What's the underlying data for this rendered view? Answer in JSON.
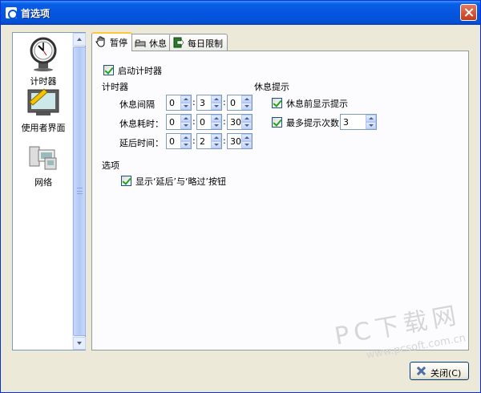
{
  "window": {
    "title": "首选项"
  },
  "nav": {
    "items": [
      {
        "label": "计时器",
        "icon": "clock-icon"
      },
      {
        "label": "使用者界面",
        "icon": "monitor-icon"
      },
      {
        "label": "网络",
        "icon": "network-icon"
      }
    ]
  },
  "tabs": [
    {
      "label": "暂停",
      "icon": "hand-icon"
    },
    {
      "label": "休息",
      "icon": "bed-icon"
    },
    {
      "label": "每日限制",
      "icon": "exit-icon"
    }
  ],
  "panel": {
    "enable_timer": {
      "label": "启动计时器",
      "checked": true
    },
    "timer_section": {
      "heading": "计时器",
      "rows": [
        {
          "label": "休息间隔",
          "h": "0",
          "m": "3",
          "s": "0"
        },
        {
          "label": "休息耗时：",
          "h": "0",
          "m": "0",
          "s": "30"
        },
        {
          "label": "延后时间：",
          "h": "0",
          "m": "2",
          "s": "30"
        }
      ]
    },
    "reminder_section": {
      "heading": "休息提示",
      "show_before": {
        "label": "休息前显示提示",
        "checked": true
      },
      "max_reminders": {
        "label": "最多提示次数",
        "checked": true,
        "value": "3"
      }
    },
    "options_section": {
      "heading": "选项",
      "show_buttons": {
        "label": "显示‘延后’与‘略过’按钮",
        "checked": true
      }
    }
  },
  "footer": {
    "close_label": "关闭(C)"
  },
  "watermark": {
    "line1": "PC下载网",
    "line2": "www.pcsoft.com.cn"
  },
  "colors": {
    "titlebar": "#0555e0",
    "accent": "#ffc83c",
    "check": "#21a121"
  }
}
